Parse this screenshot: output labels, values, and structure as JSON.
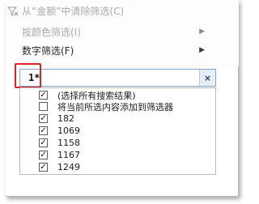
{
  "menu": {
    "clear_filter": "从“金额”中清除筛选(C)",
    "color_filter": "按颜色筛选(I)",
    "number_filter": "数字筛选(F)"
  },
  "search": {
    "value": "1*",
    "clear_label": "×"
  },
  "list": {
    "items": [
      {
        "label": "(选择所有搜索结果)",
        "checked": true
      },
      {
        "label": "将当前所选内容添加到筛选器",
        "checked": false
      },
      {
        "label": "182",
        "checked": true
      },
      {
        "label": "1069",
        "checked": true
      },
      {
        "label": "1158",
        "checked": true
      },
      {
        "label": "1167",
        "checked": true
      },
      {
        "label": "1249",
        "checked": true
      }
    ]
  },
  "colors": {
    "highlight": "#e0232a",
    "search_border": "#7fa7d2",
    "clear_button_text": "#1b3f86"
  }
}
